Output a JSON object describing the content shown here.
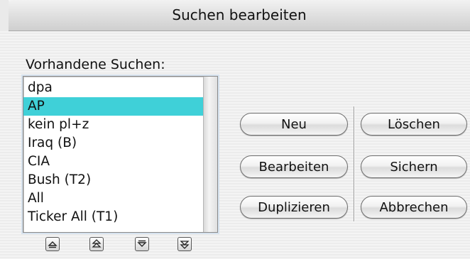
{
  "window": {
    "title": "Suchen bearbeiten"
  },
  "list": {
    "label": "Vorhandene Suchen:",
    "items": [
      "dpa",
      "AP",
      "kein pl+z",
      "Iraq (B)",
      "CIA",
      "Bush (T2)",
      "All",
      "Ticker All (T1)"
    ],
    "selected": "AP",
    "selection_color": "#3fd0d8"
  },
  "reorder_buttons": [
    "move-top-icon",
    "move-up-icon",
    "move-down-icon",
    "move-bottom-icon"
  ],
  "buttons": {
    "new": "Neu",
    "edit": "Bearbeiten",
    "duplicate": "Duplizieren",
    "delete": "Löschen",
    "save": "Sichern",
    "cancel": "Abbrechen"
  }
}
